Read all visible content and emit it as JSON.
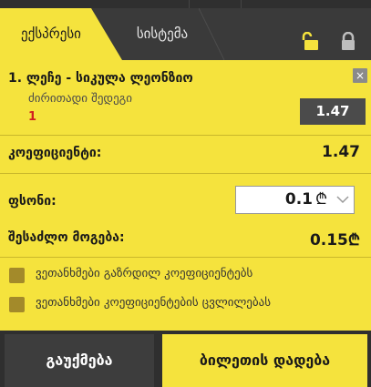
{
  "tabs": {
    "express_label": "ექსპრესი",
    "system_label": "სისტემა"
  },
  "bet": {
    "title": "1. ლეჩე - სიკულა ლეონზიო",
    "market": "ძირითადი შედეგი",
    "pick": "1",
    "odds": "1.47",
    "remove_label": "×"
  },
  "summary": {
    "coef_label": "კოეფიციენტი:",
    "coef_value": "1.47",
    "stake_label": "ფსონი:",
    "stake_value": "0.1",
    "stake_currency": "₾",
    "win_label": "შესაძლო მოგება:",
    "win_value": "0.15₾"
  },
  "options": [
    {
      "label": "ვეთანხმები გაზრდილ კოეფიციენტებს"
    },
    {
      "label": "ვეთანხმები კოეფიციენტების ცვლილებას"
    }
  ],
  "footer": {
    "cancel_label": "გაუქმება",
    "place_label": "ბილეთის დადება"
  },
  "colors": {
    "accent": "#f5e33d",
    "dark": "#3a3a3a",
    "pick": "#d02020"
  }
}
